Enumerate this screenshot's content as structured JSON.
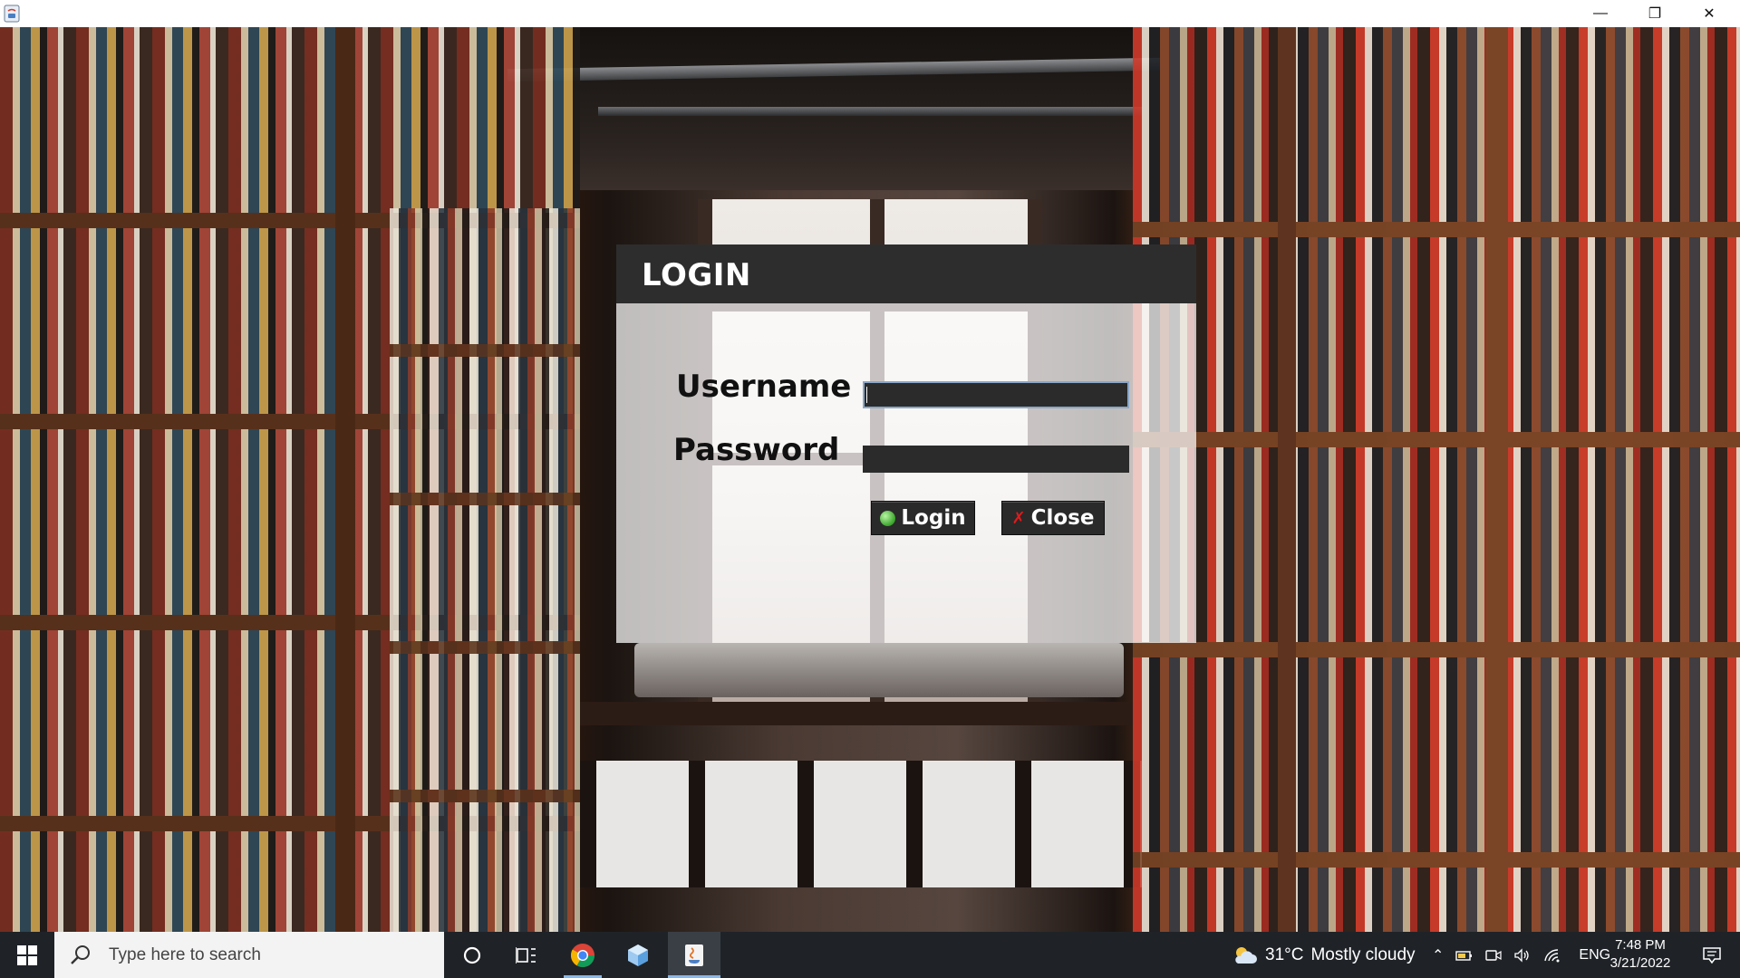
{
  "window": {
    "minimize_glyph": "—",
    "maximize_glyph": "❐",
    "close_glyph": "✕"
  },
  "login": {
    "title": "LOGIN",
    "username_label": "Username",
    "password_label": "Password",
    "username_value": "",
    "password_value": "",
    "login_button": "Login",
    "close_button": "Close",
    "close_icon_glyph": "✗"
  },
  "taskbar": {
    "search_placeholder": "Type here to search",
    "weather_temp": "31°C",
    "weather_condition": "Mostly cloudy",
    "language": "ENG",
    "time": "7:48 PM",
    "date": "3/21/2022"
  },
  "icons": {
    "app": "java-app-icon",
    "start": "windows-start-icon",
    "search": "search-icon",
    "cortana": "cortana-icon",
    "task_view": "task-view-icon",
    "chrome": "chrome-icon",
    "app3d": "3d-viewer-icon",
    "java": "java-icon",
    "weather": "cloud-icon",
    "notifications": "notifications-icon"
  },
  "colors": {
    "dialog_header": "#2d2d2d",
    "input_bg": "#2b2b2b",
    "button_bg": "#2a2a2a",
    "taskbar_bg": "#1f2328"
  }
}
